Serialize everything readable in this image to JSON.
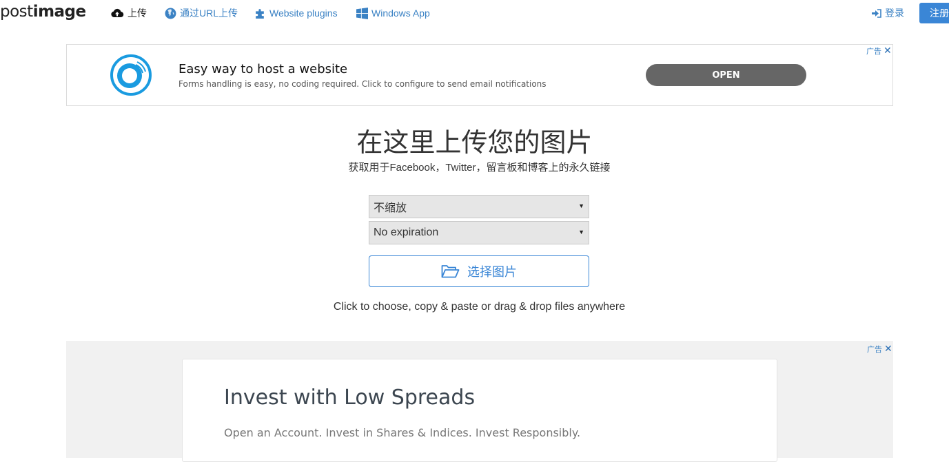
{
  "header": {
    "logo_part1": "post",
    "logo_part2": "image",
    "nav": {
      "upload": "上传",
      "upload_by_url": "通过URL上传",
      "website_plugins": "Website plugins",
      "windows_app": "Windows App"
    },
    "login": "登录",
    "register": "注册"
  },
  "ad_top": {
    "choice_label": "广告",
    "title": "Easy way to host a website",
    "description": "Forms handling is easy, no coding required. Click to configure to send email notifications",
    "button": "OPEN"
  },
  "main": {
    "title": "在这里上传您的图片",
    "subtitle": "获取用于Facebook，Twitter，留言板和博客上的永久链接",
    "resize_select": "不缩放",
    "expiration_select": "No expiration",
    "choose_button": "选择图片",
    "hint": "Click to choose, copy & paste or drag & drop files anywhere"
  },
  "ad_bottom": {
    "choice_label": "广告",
    "title": "Invest with Low Spreads",
    "description": "Open an Account. Invest in Shares & Indices. Invest Responsibly."
  },
  "colors": {
    "accent": "#3a86d6",
    "link": "#3b82c4",
    "ad_button": "#666666"
  }
}
